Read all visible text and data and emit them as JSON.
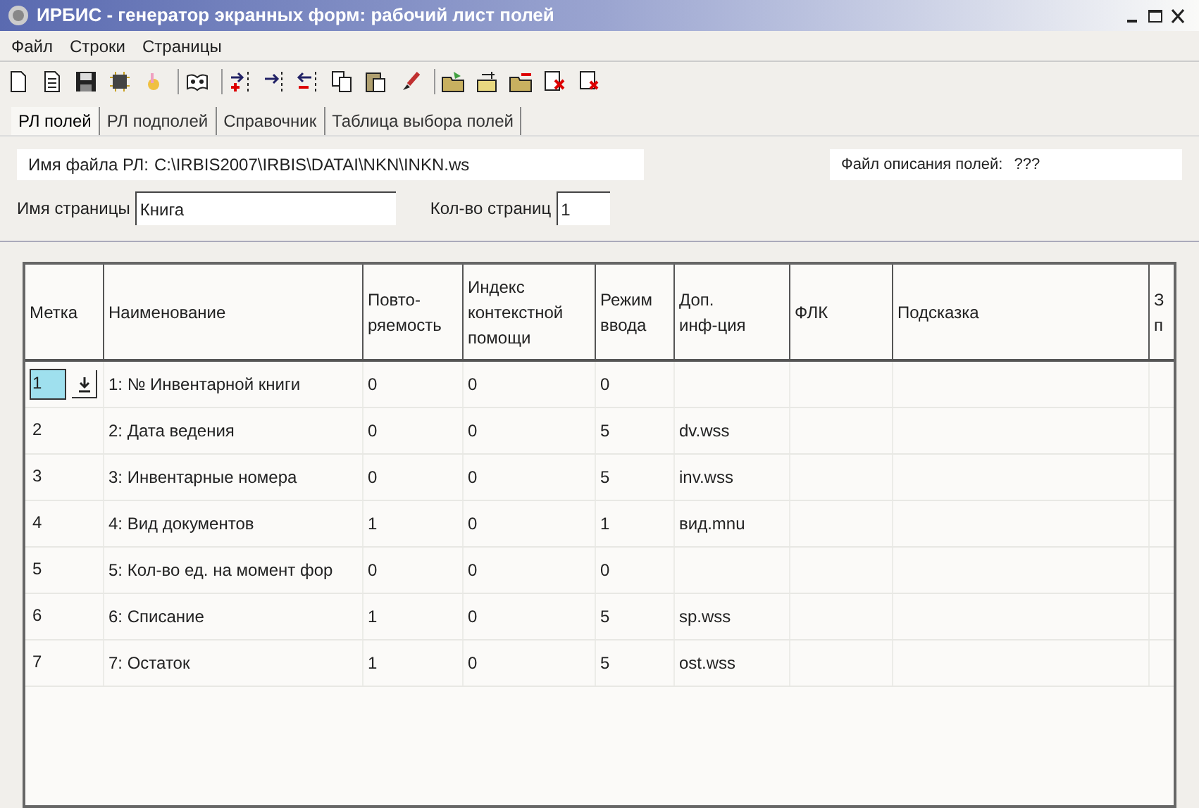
{
  "window": {
    "title": "ИРБИС - генератор экранных форм: рабочий лист полей"
  },
  "menu": [
    "Файл",
    "Строки",
    "Страницы"
  ],
  "tabs": [
    {
      "label": "РЛ полей",
      "selected": true
    },
    {
      "label": "РЛ подполей",
      "selected": false
    },
    {
      "label": "Справочник",
      "selected": false
    },
    {
      "label": "Таблица выбора полей",
      "selected": false
    }
  ],
  "file_name": {
    "label": "Имя файла РЛ:",
    "value": "C:\\IRBIS2007\\IRBIS\\DATAI\\NKN\\INKN.ws"
  },
  "field_description_file": {
    "label": "Файл описания полей:",
    "value": "???"
  },
  "page_name": {
    "label": "Имя страницы",
    "value": "Книга"
  },
  "page_count": {
    "label": "Кол-во страниц",
    "value": "1"
  },
  "table": {
    "columns": [
      {
        "lines": [
          "Метка"
        ]
      },
      {
        "lines": [
          "Наименование"
        ]
      },
      {
        "lines": [
          "Повто-",
          "ряемость"
        ]
      },
      {
        "lines": [
          "Индекс",
          "контекстной",
          "помощи"
        ]
      },
      {
        "lines": [
          "Режим",
          "ввода"
        ]
      },
      {
        "lines": [
          "Доп.",
          "инф-ция"
        ]
      },
      {
        "lines": [
          "ФЛК"
        ]
      },
      {
        "lines": [
          "Подсказка"
        ]
      },
      {
        "lines": [
          "З",
          "п"
        ]
      }
    ],
    "rows": [
      {
        "selected": true,
        "cells": [
          "1",
          "1: № Инвентарной книги",
          "0",
          "0",
          "0",
          "",
          "",
          "",
          ""
        ]
      },
      {
        "selected": false,
        "cells": [
          "2",
          "2: Дата ведения",
          "0",
          "0",
          "5",
          "dv.wss",
          "",
          "",
          ""
        ]
      },
      {
        "selected": false,
        "cells": [
          "3",
          "3: Инвентарные номера",
          "0",
          "0",
          "5",
          "inv.wss",
          "",
          "",
          ""
        ]
      },
      {
        "selected": false,
        "cells": [
          "4",
          "4: Вид документов",
          "1",
          "0",
          "1",
          "вид.mnu",
          "",
          "",
          ""
        ]
      },
      {
        "selected": false,
        "cells": [
          "5",
          "5: Кол-во ед. на момент фор",
          "0",
          "0",
          "0",
          "",
          "",
          "",
          ""
        ]
      },
      {
        "selected": false,
        "cells": [
          "6",
          "6: Списание",
          "1",
          "0",
          "5",
          "sp.wss",
          "",
          "",
          ""
        ]
      },
      {
        "selected": false,
        "cells": [
          "7",
          "7: Остаток",
          "1",
          "0",
          "5",
          "ost.wss",
          "",
          "",
          ""
        ]
      }
    ]
  }
}
